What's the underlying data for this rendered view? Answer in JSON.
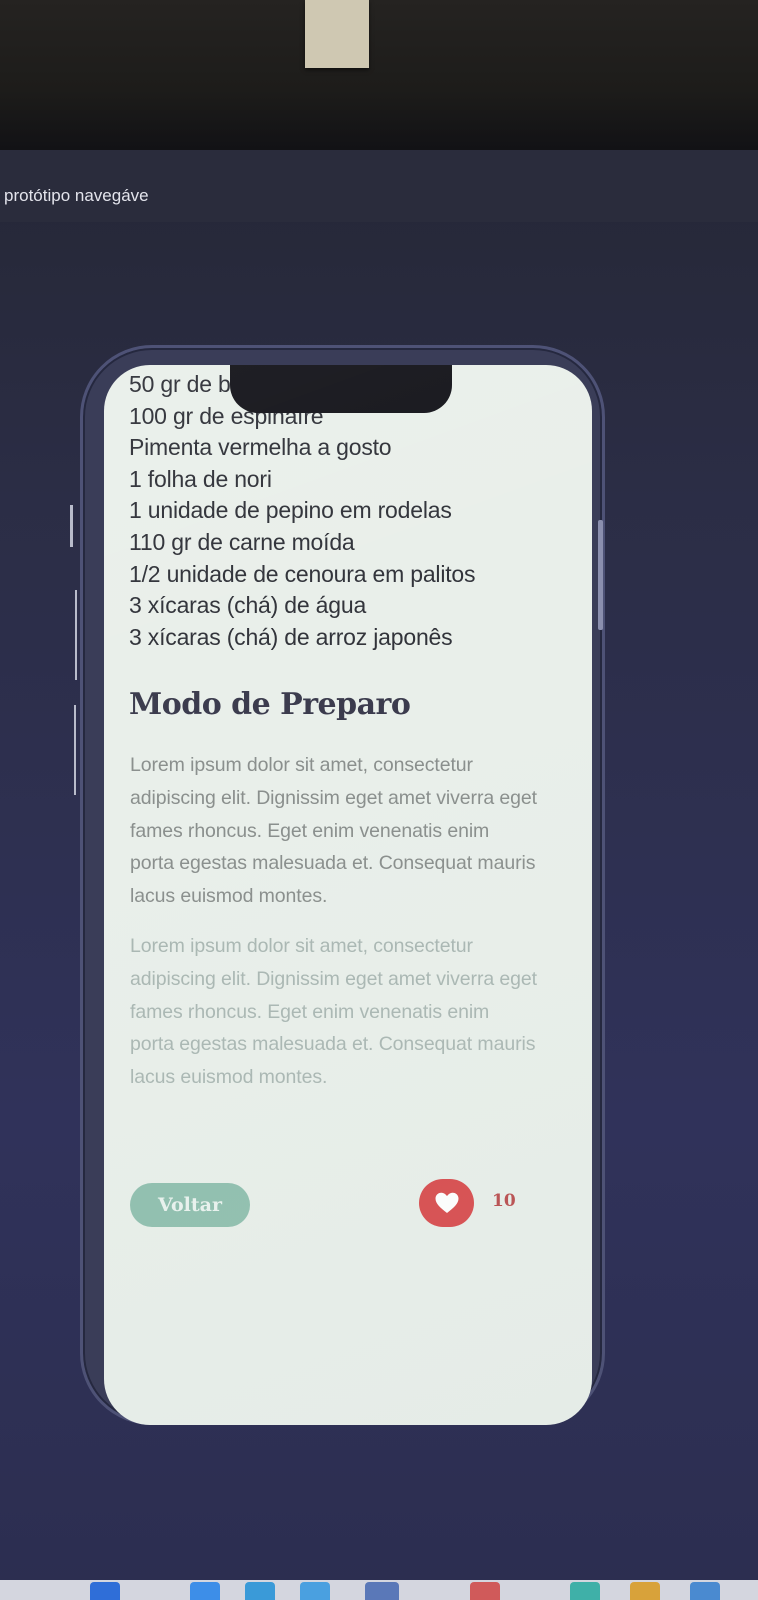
{
  "browser": {
    "caption": "protótipo navegáve"
  },
  "recipe": {
    "ingredients": [
      "50 gr de b",
      "100 gr de espinafre",
      "Pimenta vermelha a gosto",
      "1 folha de nori",
      "1 unidade de pepino em rodelas",
      "110 gr de carne moída",
      "1/2 unidade de cenoura em palitos",
      "3 xícaras (chá) de água",
      "3 xícaras (chá) de arroz japonês"
    ],
    "preparation_title": "Modo de Preparo",
    "paragraphs": [
      "Lorem ipsum dolor sit amet, consectetur adipiscing elit. Dignissim eget amet viverra eget fames rhoncus. Eget enim venenatis enim porta egestas malesuada et. Consequat mauris lacus euismod montes.",
      "Lorem ipsum dolor sit amet, consectetur adipiscing elit. Dignissim eget amet viverra eget fames rhoncus. Eget enim venenatis enim porta egestas malesuada et. Consequat mauris lacus euismod montes."
    ]
  },
  "actions": {
    "back_label": "Voltar",
    "like_count": "10",
    "like_icon": "heart-icon"
  },
  "colors": {
    "screen_bg": "#e9efea",
    "back_button": "#8fbfae",
    "like_button": "#d8494b",
    "heading": "#3a3a4c"
  }
}
